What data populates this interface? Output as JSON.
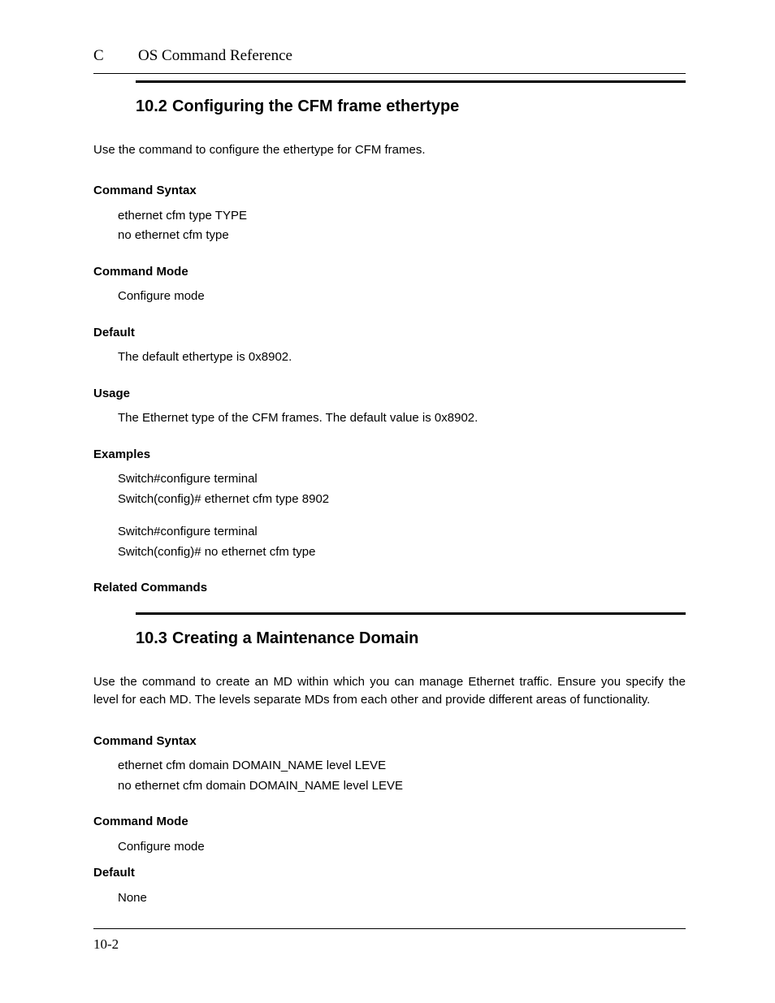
{
  "header": {
    "letter": "C",
    "title": "OS Command Reference"
  },
  "sections": [
    {
      "number": "10.2",
      "title": "Configuring the CFM frame ethertype",
      "intro": "Use the command to configure the ethertype for CFM frames.",
      "syntax_label": "Command Syntax",
      "syntax": [
        "ethernet cfm type TYPE",
        "no ethernet cfm type"
      ],
      "mode_label": "Command Mode",
      "mode": "Configure mode",
      "default_label": "Default",
      "default": "The default ethertype is 0x8902.",
      "usage_label": "Usage",
      "usage": "The Ethernet type of the CFM frames. The default value is 0x8902.",
      "examples_label": "Examples",
      "examples": [
        [
          "Switch#configure terminal",
          "Switch(config)# ethernet cfm type 8902"
        ],
        [
          "Switch#configure terminal",
          "Switch(config)# no ethernet cfm type"
        ]
      ],
      "related_label": "Related Commands"
    },
    {
      "number": "10.3",
      "title": "Creating a Maintenance Domain",
      "intro": "Use the command to create an MD within which you can manage Ethernet traffic. Ensure you specify the level for each MD. The levels separate MDs from each other and provide different areas of functionality.",
      "syntax_label": "Command Syntax",
      "syntax": [
        "ethernet cfm domain DOMAIN_NAME level LEVE",
        "no ethernet cfm domain DOMAIN_NAME level LEVE"
      ],
      "mode_label": "Command Mode",
      "mode": "Configure mode",
      "default_label": "Default",
      "default": "None"
    }
  ],
  "page_number": "10-2"
}
